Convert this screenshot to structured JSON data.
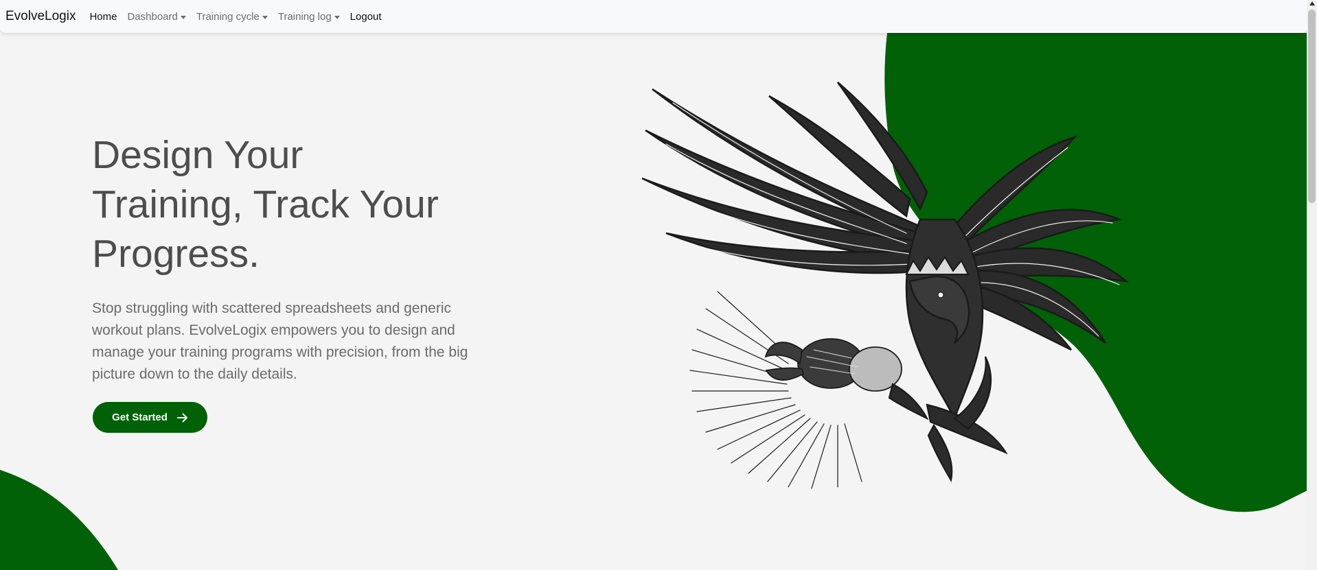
{
  "navbar": {
    "brand": "EvolveLogix",
    "items": [
      {
        "label": "Home",
        "dropdown": false
      },
      {
        "label": "Dashboard",
        "dropdown": true
      },
      {
        "label": "Training cycle",
        "dropdown": true
      },
      {
        "label": "Training log",
        "dropdown": true
      },
      {
        "label": "Logout",
        "dropdown": false
      }
    ]
  },
  "hero": {
    "title_lines": [
      "Design Your",
      "Training, Track Your",
      "Progress."
    ],
    "description": "Stop struggling with scattered spreadsheets and generic workout plans. EvolveLogix empowers you to design and manage your training programs with precision, from the big picture down to the daily details.",
    "cta_label": "Get Started",
    "cta_icon": "arrow-right-icon"
  },
  "illustration": {
    "icon": "eagle-illustration"
  },
  "colors": {
    "brand_green": "#006106",
    "background": "#f4f4f4",
    "navbar_bg": "#f8f9fa"
  }
}
